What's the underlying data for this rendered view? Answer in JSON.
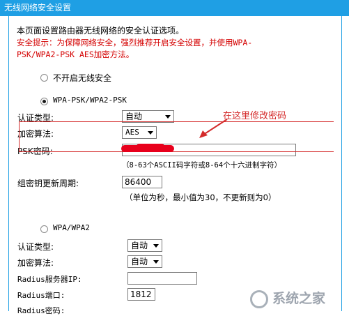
{
  "window": {
    "title": "无线网络安全设置"
  },
  "intro": {
    "desc": "本页面设置路由器无线网络的安全认证选项。",
    "warning_line1": "安全提示：为保障网络安全，强烈推荐开启安全设置，并使用WPA-",
    "warning_line2": "PSK/WPA2-PSK AES加密方法。"
  },
  "options": {
    "none_label": "不开启无线安全",
    "wpa_psk_label": "WPA-PSK/WPA2-PSK",
    "wpa_label": "WPA/WPA2",
    "selected": "wpa_psk"
  },
  "psk_section": {
    "auth_label": "认证类型:",
    "auth_value": "自动",
    "enc_label": "加密算法:",
    "enc_value": "AES",
    "psk_label": "PSK密码:",
    "psk_hint": "（8-63个ASCII码字符或8-64个十六进制字符）",
    "group_key_label": "组密钥更新周期:",
    "group_key_value": "86400",
    "group_key_hint": "（单位为秒，最小值为30，不更新则为0）"
  },
  "annotation": {
    "text": "在这里修改密码",
    "color": "#d42a2a"
  },
  "wpa_section": {
    "auth_label": "认证类型:",
    "auth_value": "自动",
    "enc_label": "加密算法:",
    "enc_value": "自动",
    "radius_ip_label": "Radius服务器IP:",
    "radius_ip_value": "",
    "radius_port_label": "Radius端口:",
    "radius_port_value": "1812",
    "radius_pwd_label": "Radius密码:"
  },
  "watermark": {
    "text": "系统之家"
  },
  "colors": {
    "titlebar": "#1f9fe4",
    "warning": "#d40000",
    "highlight": "#d42a2a"
  }
}
